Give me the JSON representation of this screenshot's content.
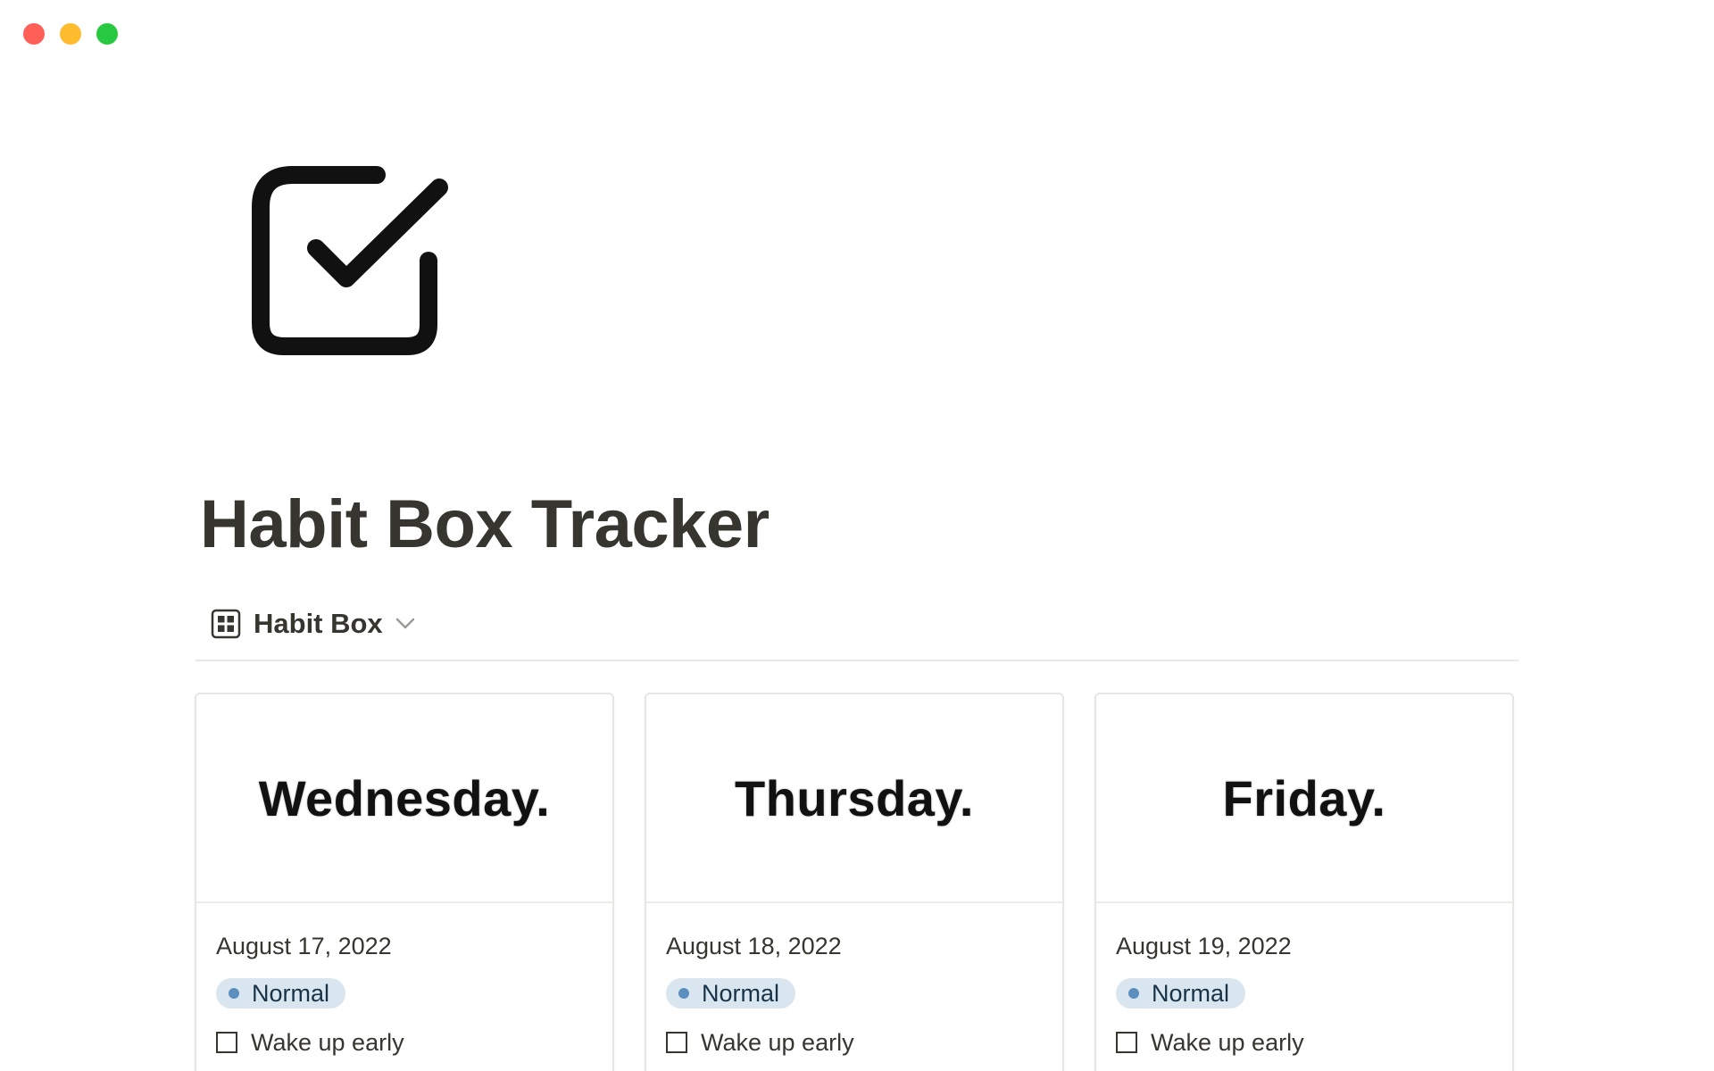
{
  "window": {
    "controls": [
      "close",
      "minimize",
      "maximize"
    ]
  },
  "page": {
    "icon": "checkbox-checked-icon",
    "title": "Habit Box Tracker"
  },
  "view": {
    "icon": "gallery-grid-icon",
    "label": "Habit Box",
    "dropdown_icon": "chevron-down-icon"
  },
  "cards": [
    {
      "cover_text": "Wednesday.",
      "date": "August 17, 2022",
      "tag": "Normal",
      "habit": "Wake up early",
      "habit_checked": false
    },
    {
      "cover_text": "Thursday.",
      "date": "August 18, 2022",
      "tag": "Normal",
      "habit": "Wake up early",
      "habit_checked": false
    },
    {
      "cover_text": "Friday.",
      "date": "August 19, 2022",
      "tag": "Normal",
      "habit": "Wake up early",
      "habit_checked": false
    }
  ],
  "colors": {
    "text": "#37352f",
    "tag_background": "#d9e6f0",
    "tag_dot": "#5b8fbf",
    "close": "#ff5f57",
    "minimize": "#febc2e",
    "maximize": "#28c840"
  }
}
